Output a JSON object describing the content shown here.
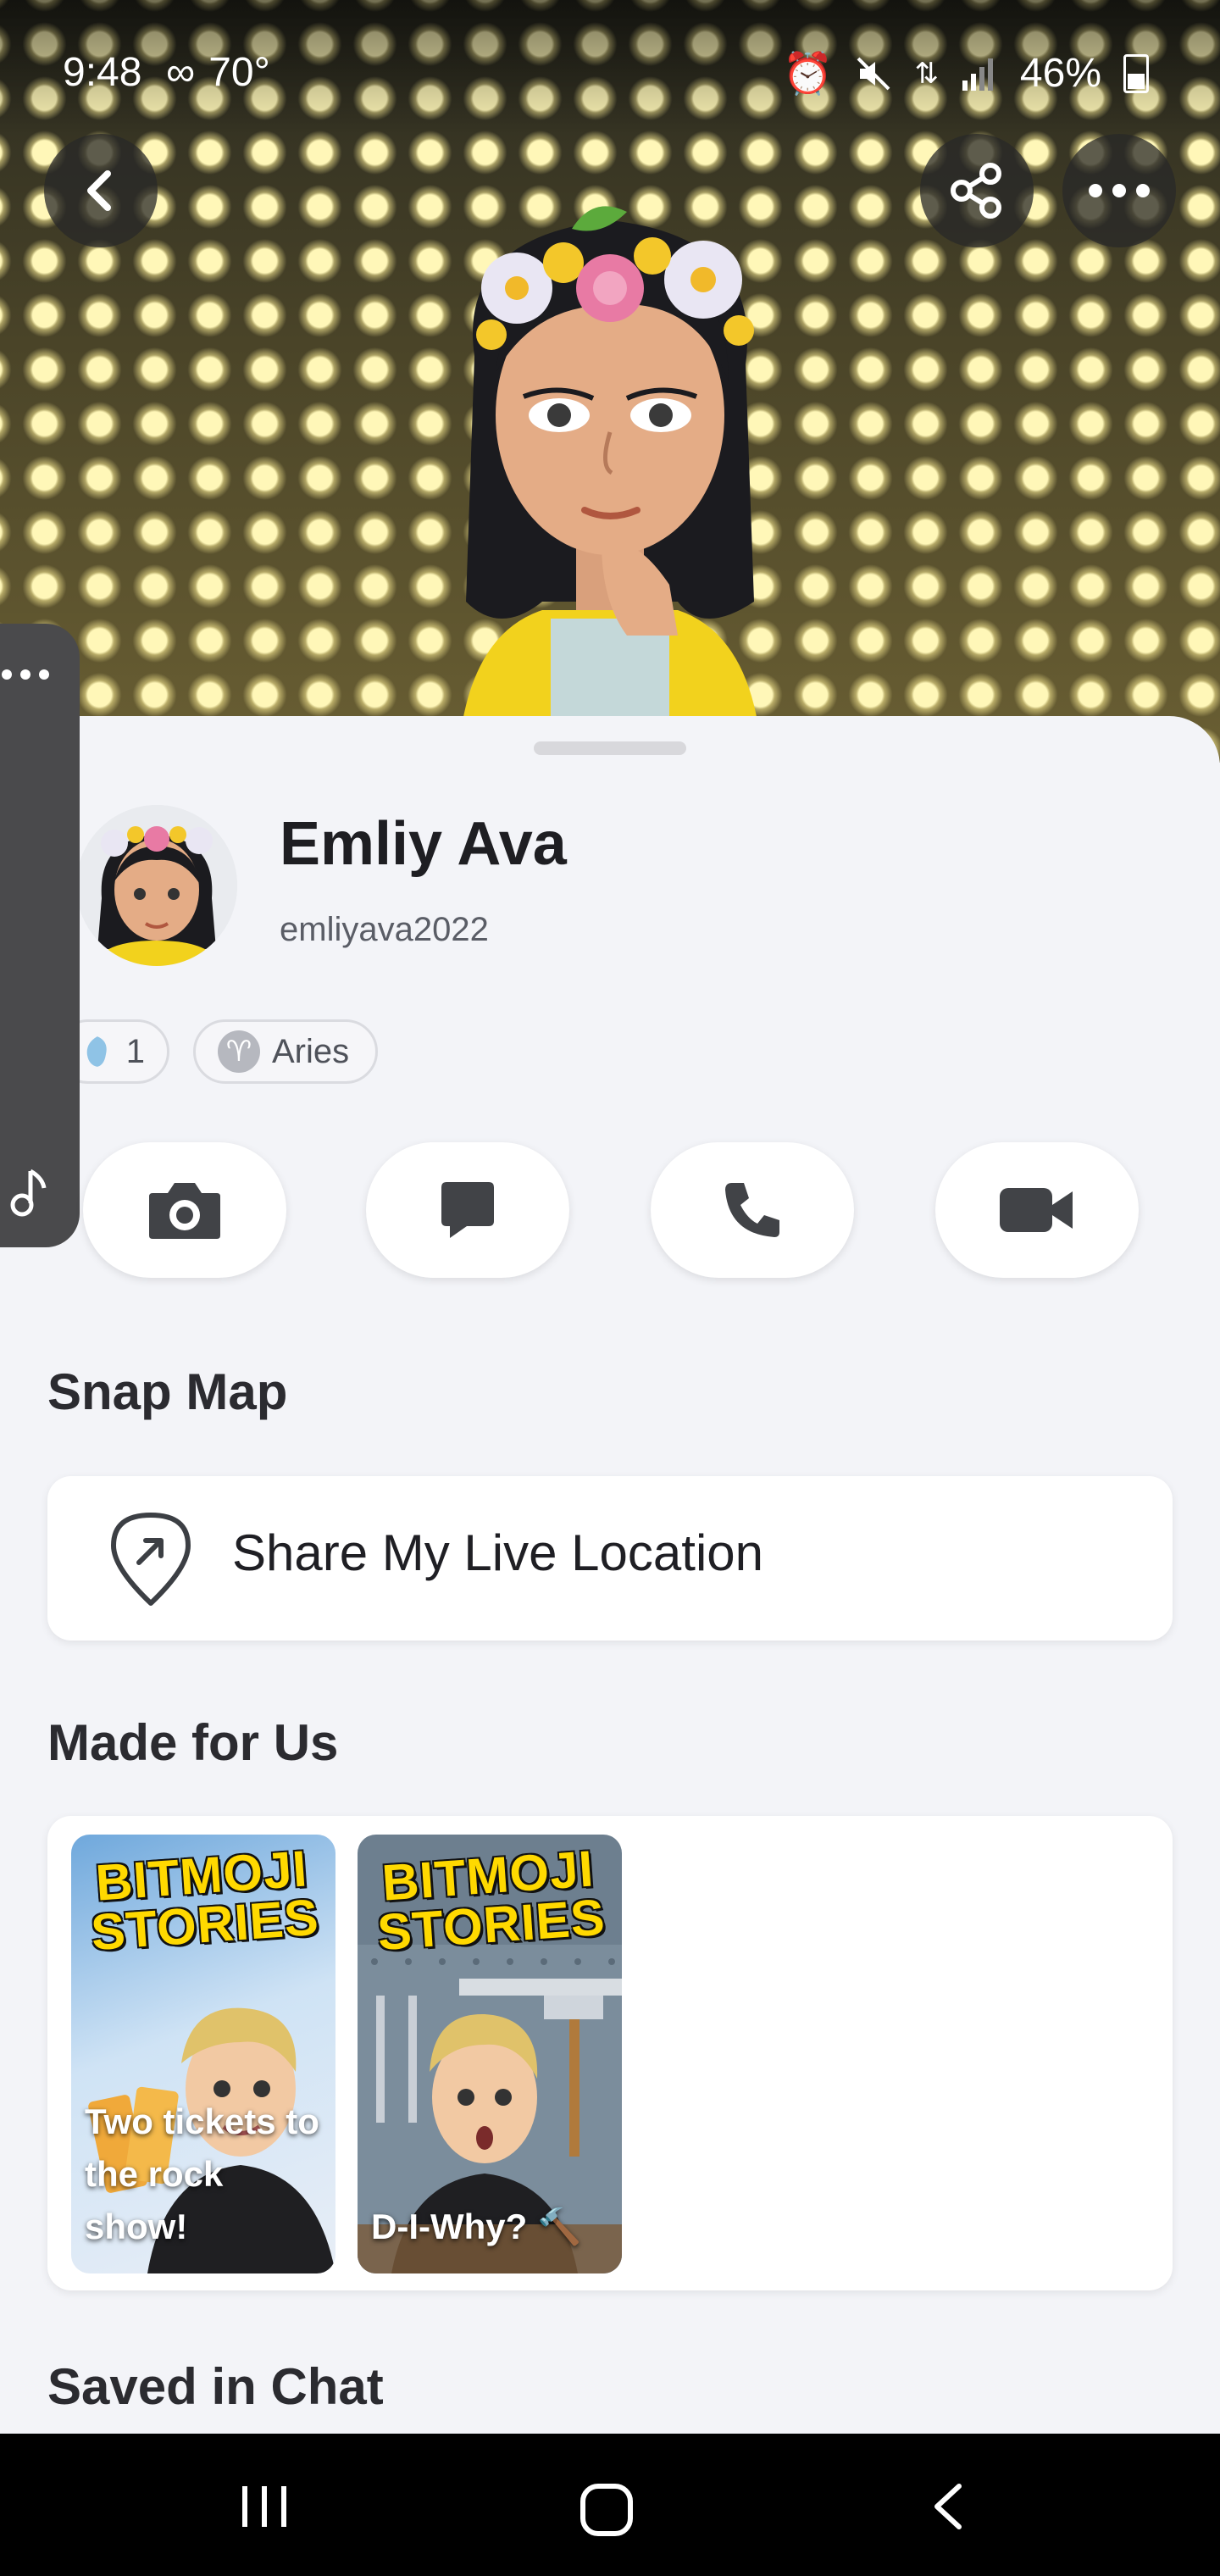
{
  "status_bar": {
    "time": "9:48",
    "temperature": "70°",
    "battery": "46%"
  },
  "profile": {
    "name": "Emliy Ava",
    "username": "emliyava2022",
    "friend_count": "1",
    "zodiac": "Aries"
  },
  "actions": [
    {
      "name": "camera",
      "icon": "camera-icon"
    },
    {
      "name": "chat",
      "icon": "chat-icon"
    },
    {
      "name": "call",
      "icon": "phone-icon"
    },
    {
      "name": "video",
      "icon": "video-icon"
    }
  ],
  "snap_map": {
    "title": "Snap Map",
    "share_label": "Share My Live Location"
  },
  "made_for_us": {
    "title": "Made for Us",
    "stories": [
      {
        "logo_line1": "BITMOJI",
        "logo_line2": "STORIES",
        "caption": "Two tickets to the rock show!"
      },
      {
        "logo_line1": "BITMOJI",
        "logo_line2": "STORIES",
        "caption": "D-I-Why? 🔨"
      }
    ]
  },
  "saved_in_chat": {
    "title": "Saved in Chat"
  },
  "colors": {
    "logo_yellow": "#ffd900",
    "panel_bg": "#f3f4f8"
  }
}
